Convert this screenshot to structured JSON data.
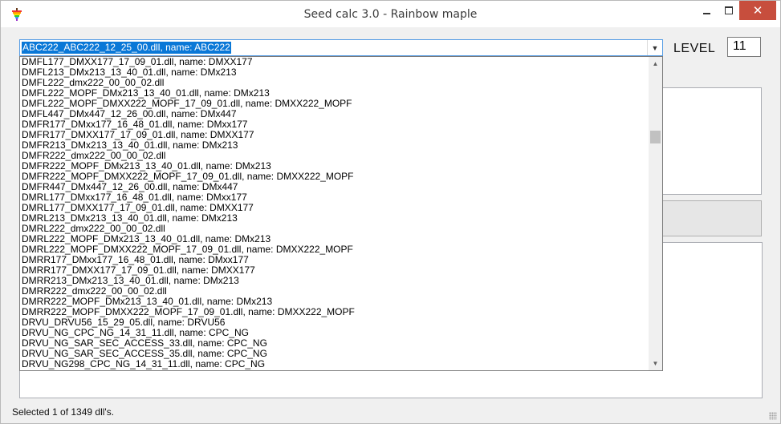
{
  "window": {
    "title": "Seed calc 3.0 - Rainbow maple",
    "close_glyph": "✕"
  },
  "level": {
    "label": "LEVEL",
    "value": "11"
  },
  "combo": {
    "selected": "ABC222_ABC222_12_25_00.dll, name: ABC222",
    "arrow_glyph": "▼"
  },
  "dropdown": {
    "items": [
      "DMFL177_DMXX177_17_09_01.dll, name: DMXX177",
      "DMFL213_DMx213_13_40_01.dll, name: DMx213",
      "DMFL222_dmx222_00_00_02.dll",
      "DMFL222_MOPF_DMx213_13_40_01.dll, name: DMx213",
      "DMFL222_MOPF_DMXX222_MOPF_17_09_01.dll, name: DMXX222_MOPF",
      "DMFL447_DMx447_12_26_00.dll, name: DMx447",
      "DMFR177_DMxx177_16_48_01.dll, name: DMxx177",
      "DMFR177_DMXX177_17_09_01.dll, name: DMXX177",
      "DMFR213_DMx213_13_40_01.dll, name: DMx213",
      "DMFR222_dmx222_00_00_02.dll",
      "DMFR222_MOPF_DMx213_13_40_01.dll, name: DMx213",
      "DMFR222_MOPF_DMXX222_MOPF_17_09_01.dll, name: DMXX222_MOPF",
      "DMFR447_DMx447_12_26_00.dll, name: DMx447",
      "DMRL177_DMxx177_16_48_01.dll, name: DMxx177",
      "DMRL177_DMXX177_17_09_01.dll, name: DMXX177",
      "DMRL213_DMx213_13_40_01.dll, name: DMx213",
      "DMRL222_dmx222_00_00_02.dll",
      "DMRL222_MOPF_DMx213_13_40_01.dll, name: DMx213",
      "DMRL222_MOPF_DMXX222_MOPF_17_09_01.dll, name: DMXX222_MOPF",
      "DMRR177_DMxx177_16_48_01.dll, name: DMxx177",
      "DMRR177_DMXX177_17_09_01.dll, name: DMXX177",
      "DMRR213_DMx213_13_40_01.dll, name: DMx213",
      "DMRR222_dmx222_00_00_02.dll",
      "DMRR222_MOPF_DMx213_13_40_01.dll, name: DMx213",
      "DMRR222_MOPF_DMXX222_MOPF_17_09_01.dll, name: DMXX222_MOPF",
      "DRVU_DRVU56_15_29_05.dll, name: DRVU56",
      "DRVU_NG_CPC_NG_14_31_11.dll, name: CPC_NG",
      "DRVU_NG_SAR_SEC_ACCESS_33.dll, name: CPC_NG",
      "DRVU_NG_SAR_SEC_ACCESS_35.dll, name: CPC_NG",
      "DRVU_NG298_CPC_NG_14_31_11.dll, name: CPC_NG"
    ],
    "scroll_up_glyph": "▲",
    "scroll_down_glyph": "▼"
  },
  "status": {
    "text": "Selected 1 of 1349 dll's."
  }
}
